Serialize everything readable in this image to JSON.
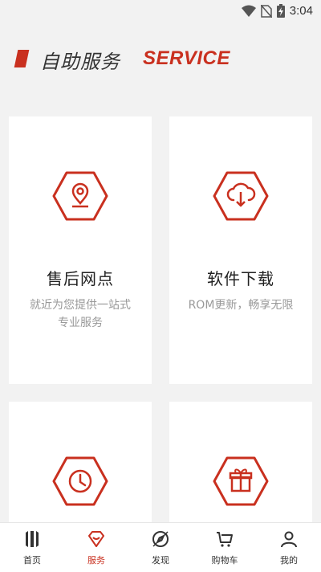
{
  "status": {
    "time": "3:04"
  },
  "header": {
    "title": "自助服务",
    "subtitle": "SERVICE"
  },
  "cards": [
    {
      "title": "售后网点",
      "desc": "就近为您提供一站式专业服务"
    },
    {
      "title": "软件下载",
      "desc": "ROM更新，畅享无限"
    },
    {
      "title": "",
      "desc": ""
    },
    {
      "title": "",
      "desc": ""
    }
  ],
  "tabs": [
    {
      "label": "首页"
    },
    {
      "label": "服务"
    },
    {
      "label": "发现"
    },
    {
      "label": "购物车"
    },
    {
      "label": "我的"
    }
  ],
  "colors": {
    "accent": "#c9301f",
    "background": "#f2f2f2",
    "card": "#ffffff"
  },
  "icons": [
    "location-pin-icon",
    "cloud-download-icon",
    "clock-icon",
    "gift-icon",
    "home-logo-icon",
    "service-diamond-icon",
    "discover-compass-icon",
    "cart-icon",
    "user-icon"
  ]
}
